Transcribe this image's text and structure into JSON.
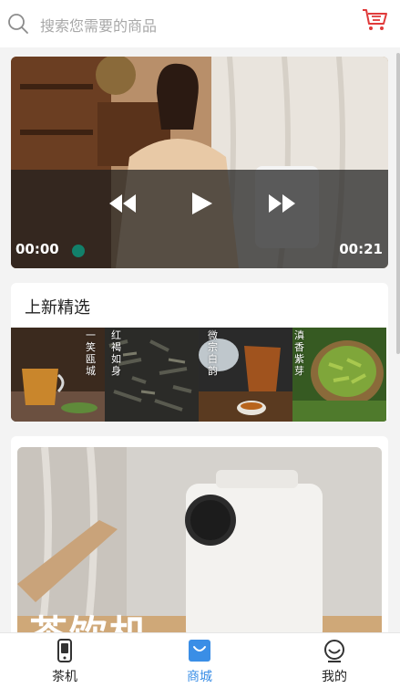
{
  "search": {
    "placeholder": "搜索您需要的商品",
    "icon": "search-icon"
  },
  "header": {
    "cart_icon": "cart-icon"
  },
  "video": {
    "current_time": "00:00",
    "total_time": "00:21",
    "controls": [
      "rewind-icon",
      "play-icon",
      "fast-forward-icon"
    ]
  },
  "new_arrivals": {
    "title": "上新精选",
    "items": [
      {
        "text": "一笑瓯城"
      },
      {
        "text": "红褐如身"
      },
      {
        "text": "微宗白韵"
      },
      {
        "text": "滇香紫芽"
      }
    ]
  },
  "promo": {
    "title": "茶饮机"
  },
  "tabbar": {
    "tabs": [
      {
        "label": "茶机",
        "icon": "phone-icon",
        "active": false
      },
      {
        "label": "商城",
        "icon": "shopping-bag-icon",
        "active": true
      },
      {
        "label": "我的",
        "icon": "user-profile-icon",
        "active": false
      }
    ]
  },
  "colors": {
    "accent": "#3a8ee6",
    "cart": "#e03a3a",
    "progress": "#12806a",
    "text_dark": "#222222",
    "placeholder": "#a8a8a8"
  }
}
